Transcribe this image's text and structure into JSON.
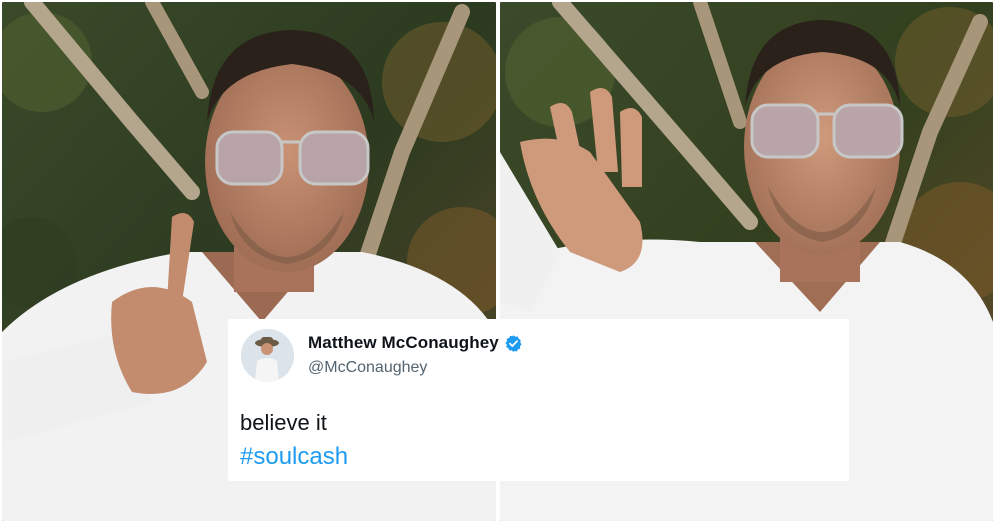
{
  "tweet": {
    "display_name": "Matthew McConaughey",
    "handle": "@McConaughey",
    "verified": true,
    "text": "believe it",
    "hashtag": "#soulcash",
    "colors": {
      "link": "#1d9bf0",
      "verified_badge": "#1d9bf0",
      "name": "#0f1419",
      "handle": "#536471"
    }
  },
  "photos": [
    {
      "subject": "man in white shirt and tinted sunglasses gesturing with right hand"
    },
    {
      "subject": "man in white shirt and tinted sunglasses raising open hand"
    }
  ]
}
